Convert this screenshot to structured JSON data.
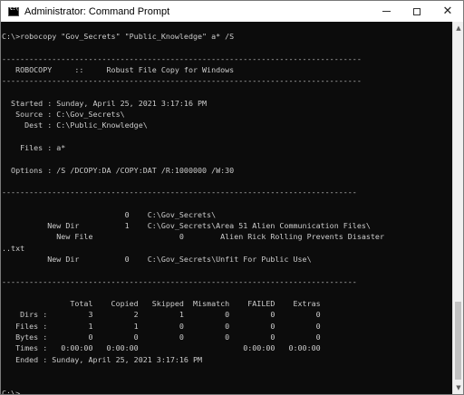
{
  "window": {
    "title": "Administrator: Command Prompt",
    "icon": "cmd-icon",
    "controls": {
      "minimize": "minimize",
      "maximize": "maximize",
      "close": "✕"
    }
  },
  "console": {
    "lines": [
      "C:\\>robocopy \"Gov_Secrets\" \"Public_Knowledge\" a* /S",
      "",
      "-------------------------------------------------------------------------------",
      "   ROBOCOPY     ::     Robust File Copy for Windows",
      "-------------------------------------------------------------------------------",
      "",
      "  Started : Sunday, April 25, 2021 3:17:16 PM",
      "   Source : C:\\Gov_Secrets\\",
      "     Dest : C:\\Public_Knowledge\\",
      "",
      "    Files : a*",
      "",
      "  Options : /S /DCOPY:DA /COPY:DAT /R:1000000 /W:30",
      "",
      "------------------------------------------------------------------------------",
      "",
      "                           0    C:\\Gov_Secrets\\",
      "          New Dir          1    C:\\Gov_Secrets\\Area 51 Alien Communication Files\\",
      "            New File                   0        Alien Rick Rolling Prevents Disaster",
      "..txt",
      "          New Dir          0    C:\\Gov_Secrets\\Unfit For Public Use\\",
      "",
      "------------------------------------------------------------------------------",
      "",
      "               Total    Copied   Skipped  Mismatch    FAILED    Extras",
      "    Dirs :         3         2         1         0         0         0",
      "   Files :         1         1         0         0         0         0",
      "   Bytes :         0         0         0         0         0         0",
      "   Times :   0:00:00   0:00:00                       0:00:00   0:00:00",
      "   Ended : Sunday, April 25, 2021 3:17:16 PM",
      "",
      "",
      "C:\\>"
    ]
  },
  "scrollbar": {
    "up_icon": "▲",
    "down_icon": "▼",
    "position": 1.0
  }
}
